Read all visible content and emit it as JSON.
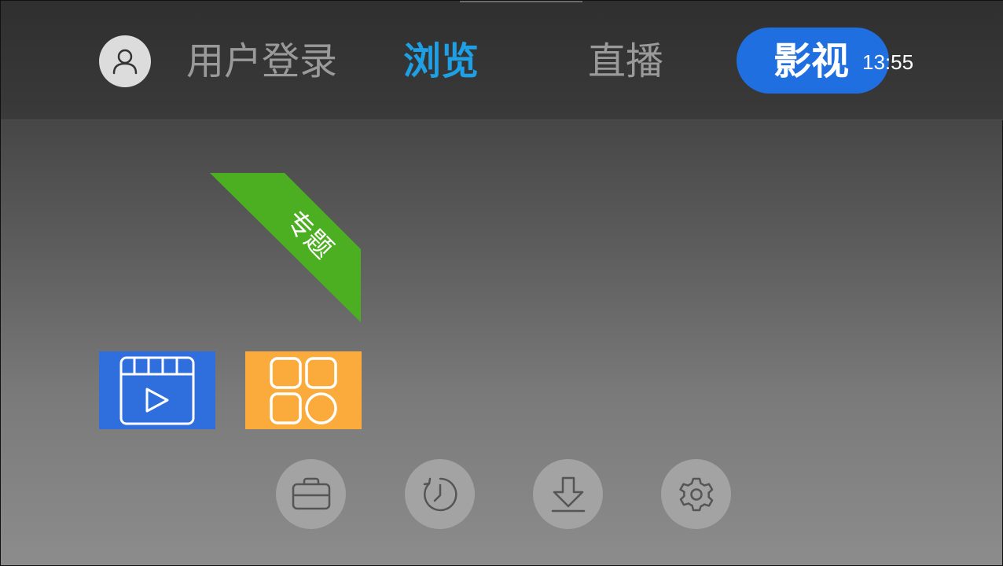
{
  "nav": {
    "login_label": "用户登录",
    "browse_label": "浏览",
    "live_label": "直播",
    "movie_label": "影视",
    "active_tab": "浏览",
    "highlighted_tab": "影视"
  },
  "status": {
    "time": "13:55"
  },
  "ribbon": {
    "label": "专题",
    "color": "#4caf22"
  },
  "tiles": [
    {
      "icon": "video-play-icon",
      "color": "#2f6fdd"
    },
    {
      "icon": "apps-grid-icon",
      "color": "#fbab3c"
    }
  ],
  "actions": [
    {
      "icon": "folder-icon"
    },
    {
      "icon": "history-clock-icon"
    },
    {
      "icon": "download-icon"
    },
    {
      "icon": "settings-gear-icon"
    }
  ],
  "colors": {
    "accent_blue": "#1ea0e6",
    "pill_blue": "#1f6fe0",
    "inactive_text": "#9a9a9a"
  }
}
